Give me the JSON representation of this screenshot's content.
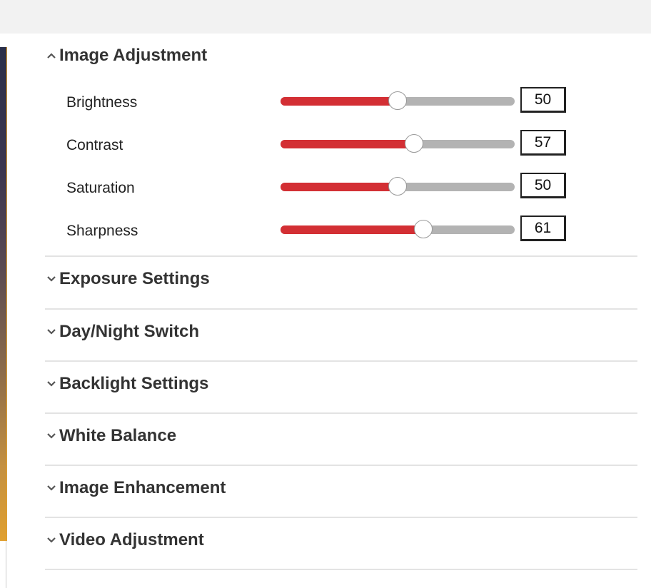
{
  "colors": {
    "accent": "#d32f34",
    "track": "#b3b3b3",
    "header_bar": "#f2f2f2",
    "divider": "#e3e3e3"
  },
  "image_adjustment": {
    "title": "Image Adjustment",
    "icon": "chevron-up-icon",
    "expanded": true,
    "settings": [
      {
        "label": "Brightness",
        "value": "50",
        "min": 0,
        "max": 100
      },
      {
        "label": "Contrast",
        "value": "57",
        "min": 0,
        "max": 100
      },
      {
        "label": "Saturation",
        "value": "50",
        "min": 0,
        "max": 100
      },
      {
        "label": "Sharpness",
        "value": "61",
        "min": 0,
        "max": 100
      }
    ]
  },
  "collapsed_sections": [
    {
      "title": "Exposure Settings",
      "icon": "chevron-down-icon"
    },
    {
      "title": "Day/Night Switch",
      "icon": "chevron-down-icon"
    },
    {
      "title": "Backlight Settings",
      "icon": "chevron-down-icon"
    },
    {
      "title": "White Balance",
      "icon": "chevron-down-icon"
    },
    {
      "title": "Image Enhancement",
      "icon": "chevron-down-icon"
    },
    {
      "title": "Video Adjustment",
      "icon": "chevron-down-icon"
    }
  ]
}
